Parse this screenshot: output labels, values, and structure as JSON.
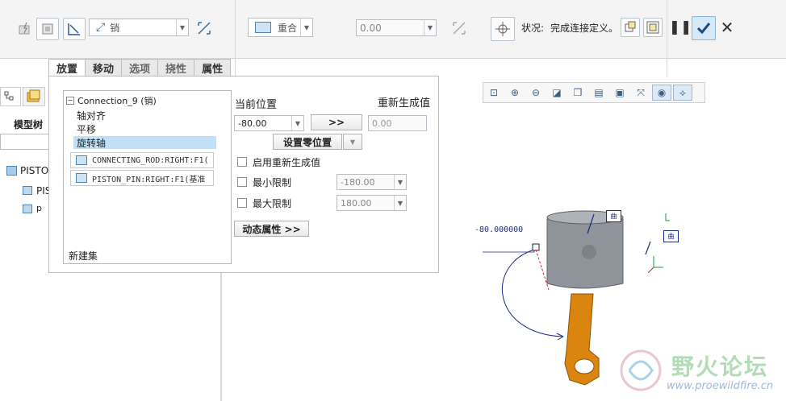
{
  "dashboard": {
    "type_value": "销",
    "angle_value": "重合",
    "offset_value": "0.00",
    "status_label": "状况:",
    "status_text": "完成连接定义。"
  },
  "tabs": [
    {
      "label": "放置"
    },
    {
      "label": "移动"
    },
    {
      "label": "选项"
    },
    {
      "label": "挠性"
    },
    {
      "label": "属性"
    }
  ],
  "placement": {
    "connection_name": "Connection_9 (销)",
    "sets": [
      "轴对齐",
      "平移",
      "旋转轴"
    ],
    "refs": [
      "CONNECTING_ROD:RIGHT:F1(",
      "PISTON_PIN:RIGHT:F1(基准"
    ],
    "new_set": "新建集",
    "current_position_label": "当前位置",
    "current_position_value": "-80.00",
    "regen_label": "重新生成值",
    "regen_value": "0.00",
    "arrow_button": ">>",
    "set_zero_button": "设置零位置",
    "enable_regen": "启用重新生成值",
    "min_limit": "最小限制",
    "min_value": "-180.00",
    "max_limit": "最大限制",
    "max_value": "180.00",
    "dynamic_props": "动态属性 >>"
  },
  "model_tree": {
    "title": "模型树",
    "root": "PISTO",
    "child1": "PIS",
    "child2": "p"
  },
  "viewport": {
    "dimension": "-80.000000",
    "tag1": "曲",
    "tag2": "曲"
  },
  "watermark": {
    "brand": "野火论坛",
    "url": "www.proewildfire.cn"
  },
  "colors": {
    "accent": "#4b86b5",
    "selected_row": "#bfe0f6",
    "piston": "#8e949a",
    "rod": "#d98510",
    "dimension": "#1b2a8a"
  }
}
